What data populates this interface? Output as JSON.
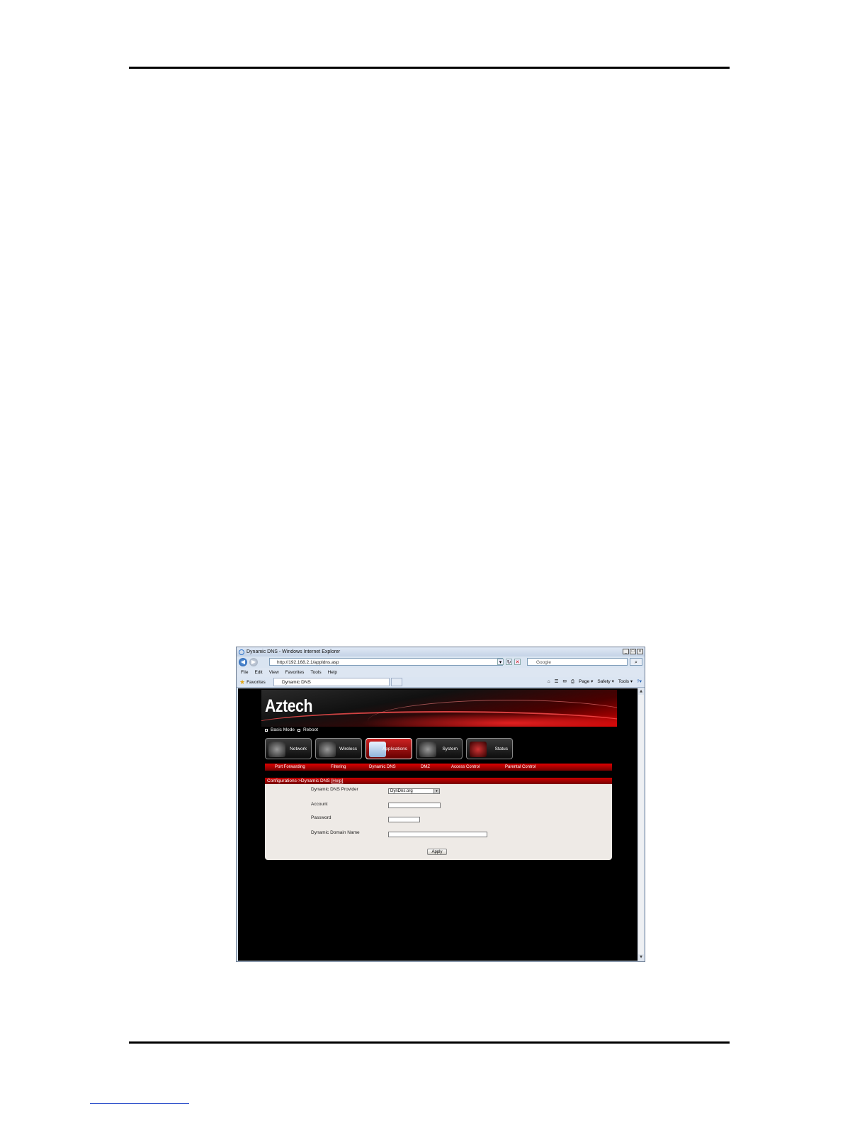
{
  "window": {
    "title": "Dynamic DNS - Windows Internet Explorer",
    "controls": [
      "_",
      "□",
      "x"
    ]
  },
  "address_bar": {
    "url": "http://192.168.2.1/appldns.asp",
    "search_placeholder": "Google"
  },
  "menu": [
    "File",
    "Edit",
    "View",
    "Favorites",
    "Tools",
    "Help"
  ],
  "favorites_bar": {
    "favorites_label": "Favorites",
    "tab_title": "Dynamic DNS",
    "commands": [
      "Page ▾",
      "Safety ▾",
      "Tools ▾",
      "?▾"
    ]
  },
  "router": {
    "brand": "Aztech",
    "quick_links": [
      "Basic Mode",
      "Reboot"
    ],
    "nav": [
      {
        "label": "Network",
        "active": false
      },
      {
        "label": "Wireless",
        "active": false
      },
      {
        "label": "Applications",
        "active": true
      },
      {
        "label": "System",
        "active": false
      },
      {
        "label": "Status",
        "active": false
      }
    ],
    "subnav": [
      "Port Forwarding",
      "Filtering",
      "Dynamic DNS",
      "DMZ",
      "Access Control",
      "Parental Control"
    ],
    "panel": {
      "breadcrumb": "Configurations->Dynamic DNS",
      "help": "[Help]",
      "fields": {
        "provider_label": "Dynamic DNS Provider",
        "provider_value": "DynDns.org",
        "account_label": "Account",
        "account_value": "",
        "password_label": "Password",
        "password_value": "",
        "domain_label": "Dynamic Domain Name",
        "domain_value": ""
      },
      "apply_label": "Apply"
    }
  }
}
